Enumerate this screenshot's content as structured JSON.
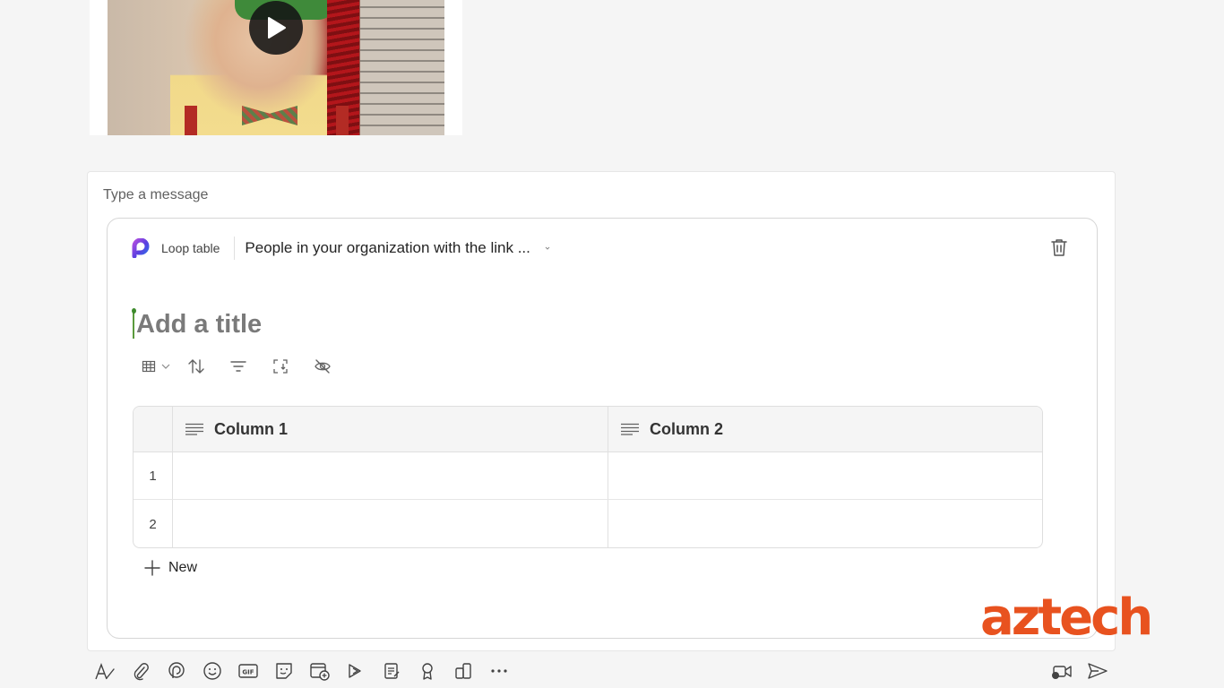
{
  "media": {
    "play_icon": "play-icon"
  },
  "compose": {
    "placeholder": "Type a message"
  },
  "loop": {
    "type_label": "Loop table",
    "share_scope": "People in your organization with the link ...",
    "title_placeholder": "Add a title",
    "toolbar_icons": [
      "table-view-icon",
      "chevron-down-icon",
      "sort-icon",
      "filter-icon",
      "resize-icon",
      "hide-icon"
    ],
    "columns": [
      "Column 1",
      "Column 2"
    ],
    "rows": [
      {
        "number": "1",
        "cells": [
          "",
          ""
        ]
      },
      {
        "number": "2",
        "cells": [
          "",
          ""
        ]
      }
    ],
    "add_row_label": "New"
  },
  "watermark": "aztech",
  "colors": {
    "loop_accent": "#7b3fe4",
    "watermark": "#e8521f",
    "caret": "#5b9a3d"
  },
  "compose_toolbar_icons": [
    "format-icon",
    "attach-icon",
    "loop-icon",
    "emoji-icon",
    "gif-icon",
    "sticker-icon",
    "schedule-meeting-icon",
    "stream-icon",
    "approvals-icon",
    "praise-icon",
    "apps-icon",
    "more-icon",
    "meet-now-icon",
    "send-icon"
  ]
}
